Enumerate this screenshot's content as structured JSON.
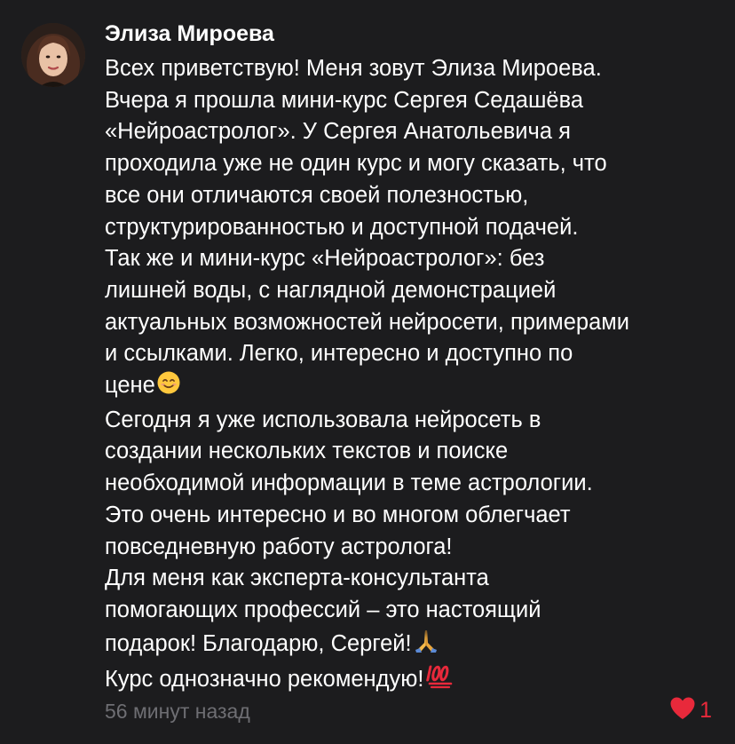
{
  "comment": {
    "author": "Элиза Мироева",
    "lines": [
      "Всех приветствую! Меня зовут Элиза Мироева.",
      "Вчера я прошла мини-курс Сергея Седашёва",
      "«Нейроастролог». У Сергея Анатольевича я",
      "проходила уже не один курс и могу сказать, что",
      "все они отличаются своей полезностью,",
      "структурированностью и доступной подачей.",
      "Так же и мини-курс «Нейроастролог»: без",
      "лишней воды, с наглядной демонстрацией",
      "актуальных возможностей нейросети, примерами",
      "и ссылками. Легко, интересно и доступно по",
      "цене",
      "Сегодня я уже использовала нейросеть в",
      "создании нескольких текстов и поиске",
      "необходимой информации в теме астрологии.",
      "Это очень интересно и во многом облегчает",
      "повседневную работу астролога!",
      "Для меня как эксперта-консультанта",
      "помогающих профессий – это настоящий",
      "подарок! Благодарю, Сергей!",
      "Курс однозначно рекомендую!"
    ],
    "emojis": {
      "line_10": "smiling-face-emoji",
      "line_18": "folded-hands-emoji",
      "line_19": "hundred-points-emoji"
    },
    "timestamp": "56 минут назад",
    "likes": "1",
    "colors": {
      "background": "#1c1c1e",
      "text": "#ffffff",
      "timestamp": "#6e6e73",
      "like": "#e8293b"
    }
  }
}
